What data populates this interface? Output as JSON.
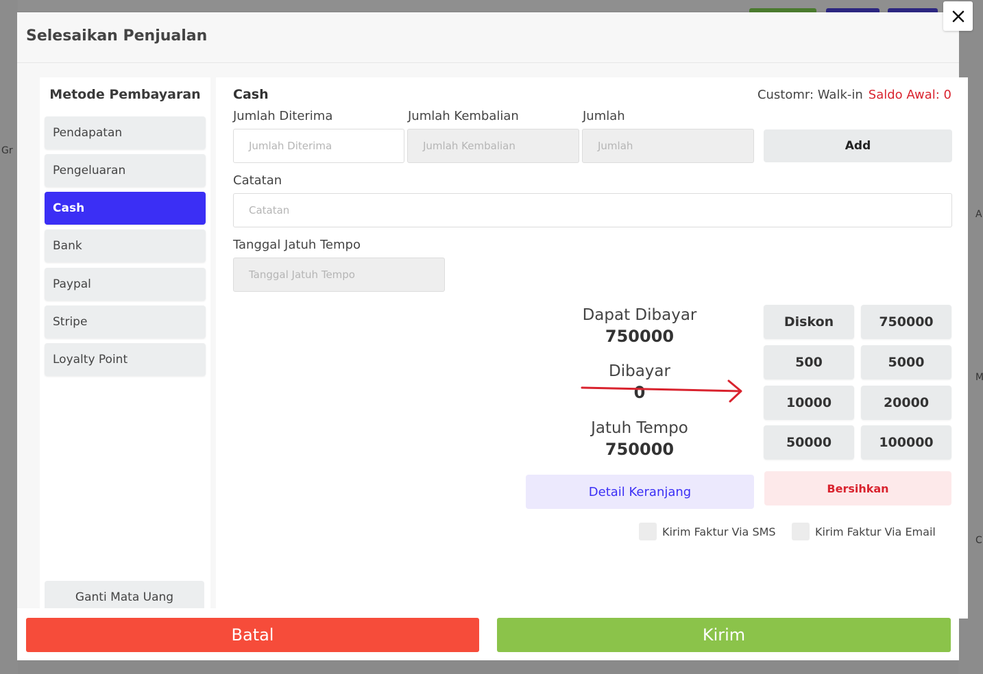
{
  "modal": {
    "title": "Selesaikan Penjualan"
  },
  "background": {
    "left_text": "Gr",
    "right_letters": [
      "A",
      "M",
      "C"
    ]
  },
  "payment_methods": {
    "title": "Metode Pembayaran",
    "items": [
      {
        "label": "Pendapatan",
        "active": false
      },
      {
        "label": "Pengeluaran",
        "active": false
      },
      {
        "label": "Cash",
        "active": true
      },
      {
        "label": "Bank",
        "active": false
      },
      {
        "label": "Paypal",
        "active": false
      },
      {
        "label": "Stripe",
        "active": false
      },
      {
        "label": "Loyalty Point",
        "active": false
      }
    ],
    "currency_button": "Ganti Mata Uang"
  },
  "form": {
    "section_title": "Cash",
    "customer_label": "Customr: Walk-in",
    "saldo_label": "Saldo Awal: 0",
    "received": {
      "label": "Jumlah Diterima",
      "placeholder": "Jumlah Diterima"
    },
    "change": {
      "label": "Jumlah Kembalian",
      "placeholder": "Jumlah Kembalian"
    },
    "amount": {
      "label": "Jumlah",
      "placeholder": "Jumlah"
    },
    "add_button": "Add",
    "note": {
      "label": "Catatan",
      "placeholder": "Catatan"
    },
    "due_date": {
      "label": "Tanggal Jatuh Tempo",
      "placeholder": "Tanggal Jatuh Tempo"
    }
  },
  "summary": {
    "payable_label": "Dapat Dibayar",
    "payable_value": "750000",
    "paid_label": "Dibayar",
    "paid_value": "0",
    "due_label": "Jatuh Tempo",
    "due_value": "750000"
  },
  "quick_amounts": [
    "Diskon",
    "750000",
    "500",
    "5000",
    "10000",
    "20000",
    "50000",
    "100000"
  ],
  "actions": {
    "cart_detail": "Detail Keranjang",
    "clear": "Bersihkan",
    "sms_invoice": "Kirim Faktur Via SMS",
    "email_invoice": "Kirim Faktur Via Email",
    "cancel": "Batal",
    "submit": "Kirim"
  },
  "colors": {
    "active_method": "#3b2ff5",
    "saldo": "#d9232e",
    "cancel": "#f64c3a",
    "submit": "#8bc34a",
    "arrow": "#d9232e"
  }
}
